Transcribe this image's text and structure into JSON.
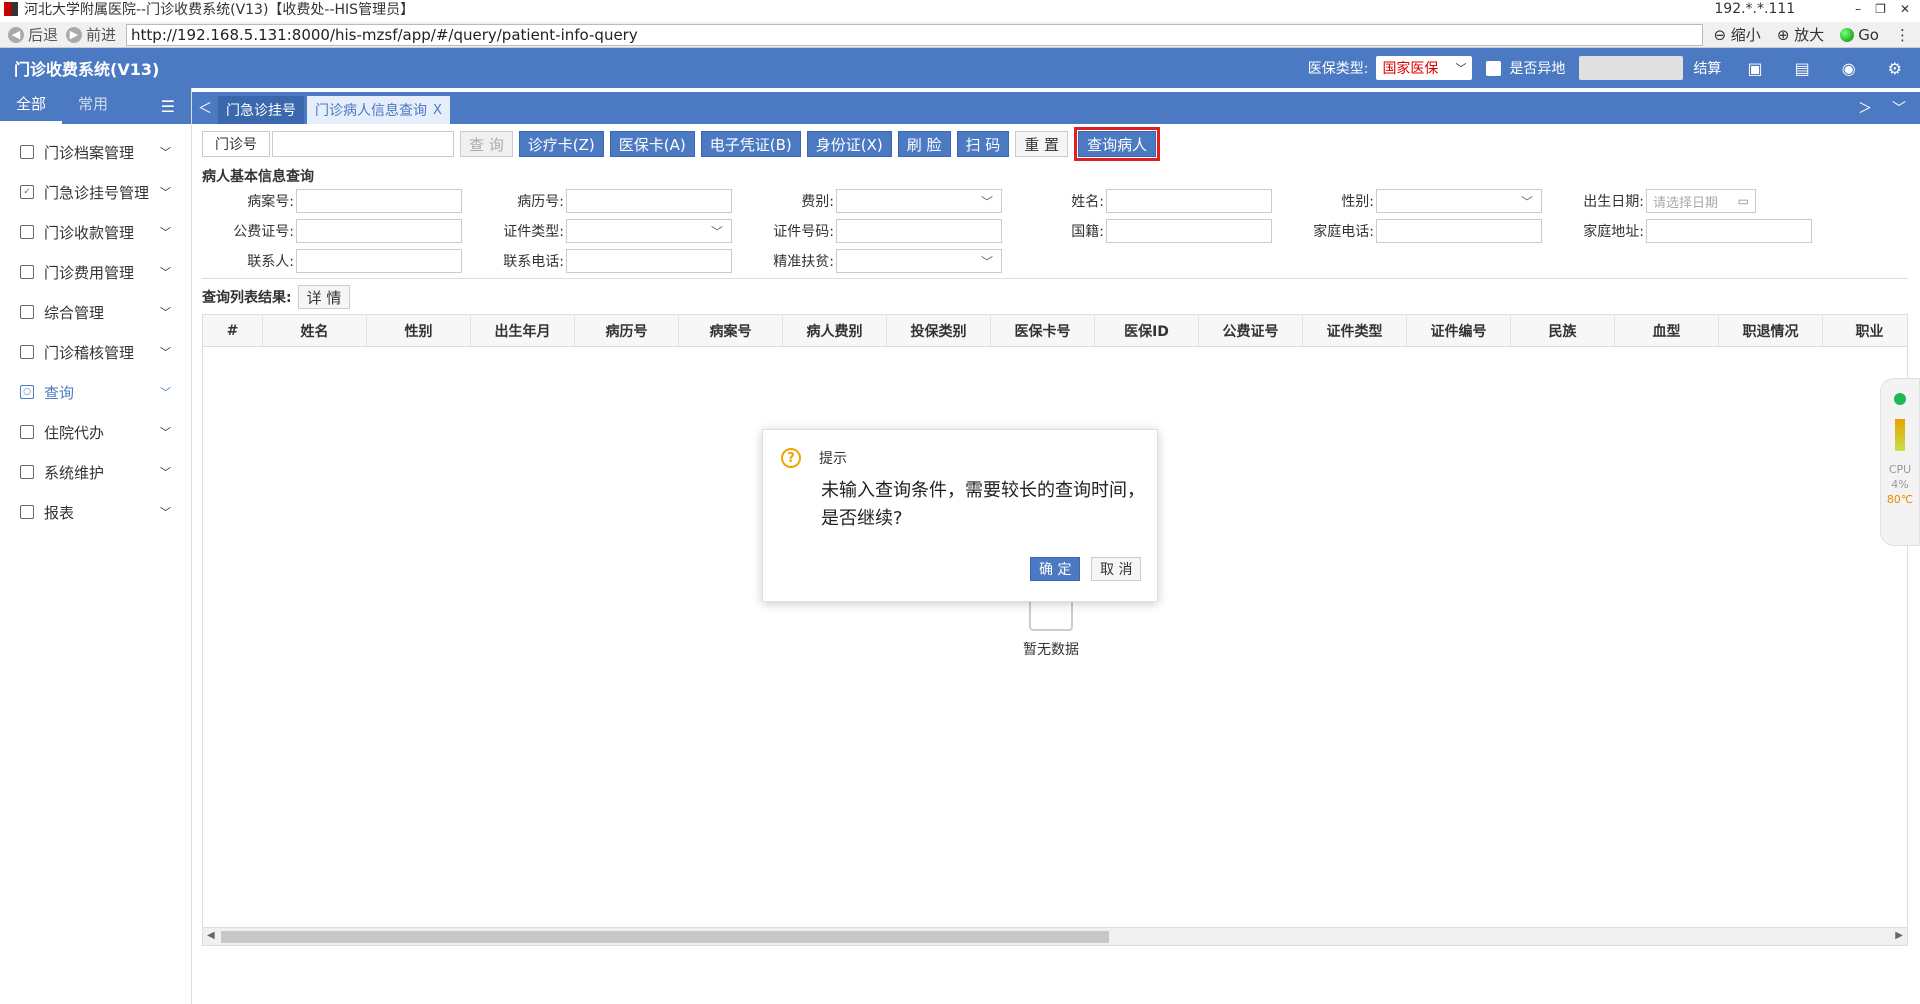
{
  "window": {
    "title": "河北大学附属医院--门诊收费系统(V13)【收费处--HIS管理员】",
    "ip": "192.*.*.111",
    "controls": [
      "–",
      "❐",
      "✕"
    ]
  },
  "browser": {
    "back": "后退",
    "forward": "前进",
    "url": "http://192.168.5.131:8000/his-mzsf/app/#/query/patient-info-query",
    "zoom_out": "缩小",
    "zoom_in": "放大",
    "go": "Go"
  },
  "header": {
    "app_title": "门诊收费系统(V13)",
    "insurance_type_label": "医保类型:",
    "insurance_type_value": "国家医保",
    "other_place_label": "是否异地",
    "settle": "结算"
  },
  "sidebar": {
    "tabs": [
      "全部",
      "常用"
    ],
    "items": [
      {
        "label": "门诊档案管理",
        "icon": "file-icon"
      },
      {
        "label": "门急诊挂号管理",
        "icon": "checklist-icon"
      },
      {
        "label": "门诊收款管理",
        "icon": "cash-icon"
      },
      {
        "label": "门诊费用管理",
        "icon": "fee-icon"
      },
      {
        "label": "综合管理",
        "icon": "manage-icon"
      },
      {
        "label": "门诊稽核管理",
        "icon": "audit-icon"
      },
      {
        "label": "查询",
        "icon": "search-icon"
      },
      {
        "label": "住院代办",
        "icon": "hospital-icon"
      },
      {
        "label": "系统维护",
        "icon": "monitor-icon"
      },
      {
        "label": "报表",
        "icon": "report-icon"
      }
    ]
  },
  "tabs": [
    {
      "label": "门急诊挂号",
      "active": false
    },
    {
      "label": "门诊病人信息查询",
      "active": true
    }
  ],
  "toolbar": {
    "field_label": "门诊号",
    "buttons": {
      "query": "查 询",
      "clinic_card": "诊疗卡(Z)",
      "insurance_card": "医保卡(A)",
      "e_voucher": "电子凭证(B)",
      "id_card": "身份证(X)",
      "face": "刷 脸",
      "scan": "扫 码",
      "reset": "重 置",
      "query_patient": "查询病人"
    }
  },
  "form": {
    "section_title": "病人基本信息查询",
    "row1": [
      "病案号:",
      "病历号:",
      "费别:",
      "姓名:",
      "性别:",
      "出生日期:"
    ],
    "row2": [
      "公费证号:",
      "证件类型:",
      "证件号码:",
      "国籍:",
      "家庭电话:",
      "家庭地址:"
    ],
    "row3": [
      "联系人:",
      "联系电话:",
      "精准扶贫:"
    ],
    "date_placeholder": "请选择日期"
  },
  "results": {
    "label": "查询列表结果:",
    "detail": "详 情",
    "columns": [
      "#",
      "姓名",
      "性别",
      "出生年月",
      "病历号",
      "病案号",
      "病人费别",
      "投保类别",
      "医保卡号",
      "医保ID",
      "公费证号",
      "证件类型",
      "证件编号",
      "民族",
      "血型",
      "职退情况",
      "职业"
    ],
    "empty_text": "暂无数据"
  },
  "cpu_widget": {
    "label": "CPU",
    "percent": "4%",
    "temp": "80℃"
  },
  "dialog": {
    "title": "提示",
    "message": "未输入查询条件，需要较长的查询时间，是否继续?",
    "ok": "确 定",
    "cancel": "取 消"
  }
}
